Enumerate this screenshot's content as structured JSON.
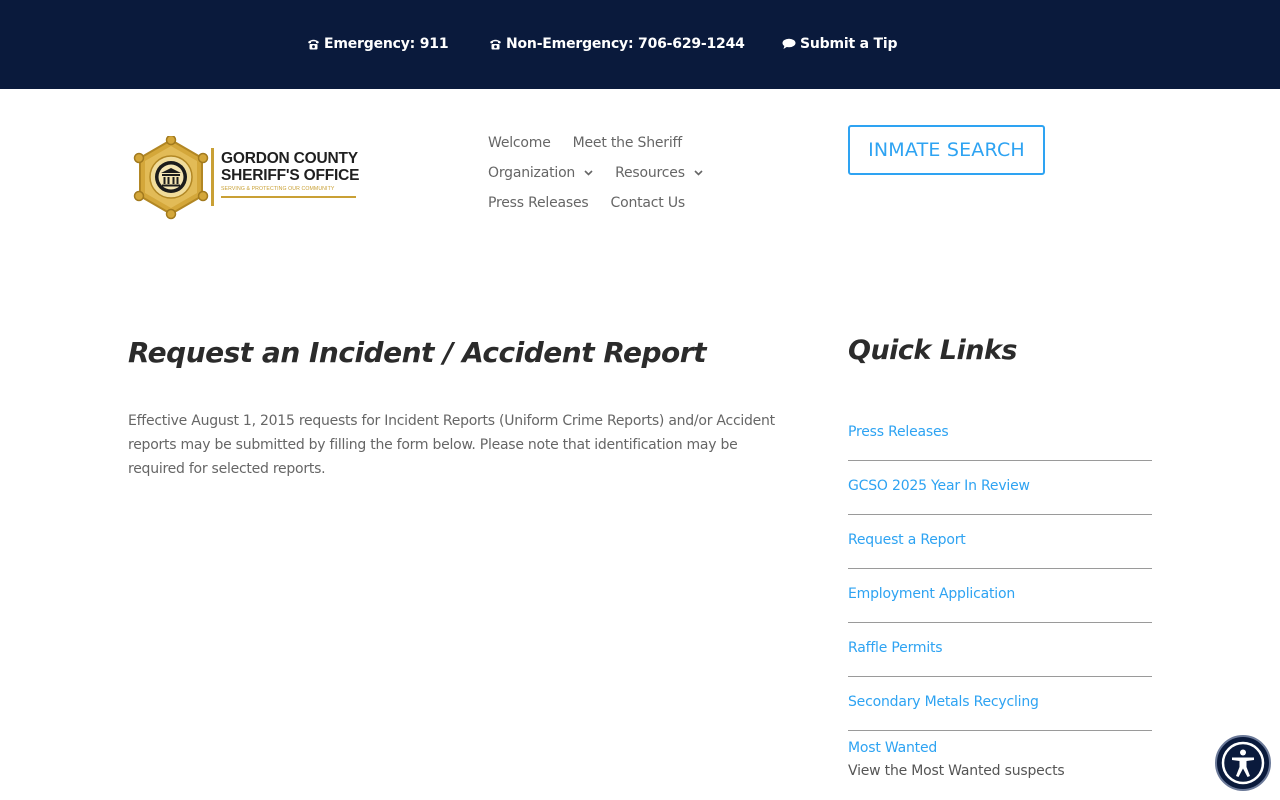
{
  "topbar": {
    "emergency": "Emergency: 911",
    "non_emergency": "Non-Emergency: 706-629-1244",
    "tip": "Submit a Tip",
    "icons": [
      "phone-icon",
      "phone-icon",
      "speech-bubble-icon"
    ]
  },
  "logo": {
    "line1": "GORDON COUNTY",
    "line2": "SHERIFF'S OFFICE",
    "tagline": "SERVING & PROTECTING OUR COMMUNITY"
  },
  "nav": {
    "items": [
      {
        "label": "Welcome"
      },
      {
        "label": "Meet the Sheriff"
      },
      {
        "label": "Organization",
        "has_dropdown": true
      },
      {
        "label": "Resources",
        "has_dropdown": true
      },
      {
        "label": "Press Releases"
      },
      {
        "label": "Contact Us"
      }
    ]
  },
  "header": {
    "inmate_search": "INMATE SEARCH"
  },
  "main": {
    "title": "Request an Incident / Accident Report",
    "body": "Effective August 1, 2015 requests for Incident Reports (Uniform Crime Reports) and/or Accident reports may be submitted by filling the form below. Please note that identification may be required for selected reports."
  },
  "sidebar": {
    "title": "Quick Links",
    "links": [
      {
        "label": "Press Releases"
      },
      {
        "label": "GCSO 2025 Year In Review"
      },
      {
        "label": "Request a Report"
      },
      {
        "label": "Employment Application"
      },
      {
        "label": "Raffle Permits"
      },
      {
        "label": "Secondary Metals Recycling"
      },
      {
        "label": "Most Wanted",
        "description": "View the Most Wanted suspects"
      }
    ]
  },
  "colors": {
    "topbar_bg": "#0a1a3c",
    "link": "#2ea3f2",
    "gold": "#c9a035",
    "heading": "#2b2b2b",
    "body_text": "#666666"
  }
}
